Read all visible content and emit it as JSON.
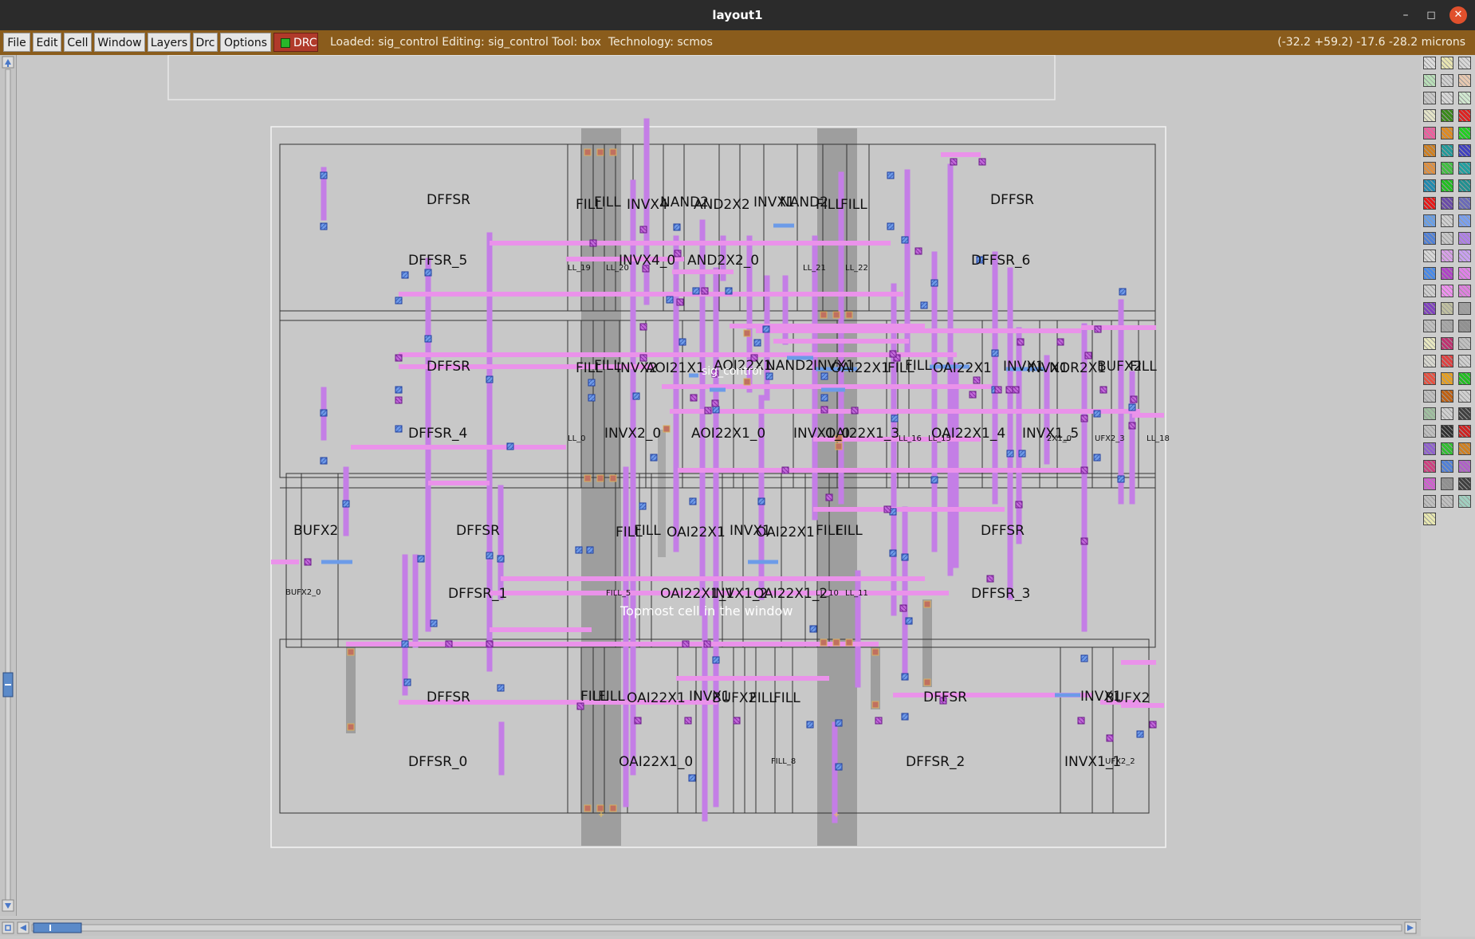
{
  "window": {
    "title": "layout1",
    "minimize": "–",
    "maximize": "◻",
    "close": "✕"
  },
  "menu": {
    "file": "File",
    "edit": "Edit",
    "cell": "Cell",
    "window": "Window",
    "layers": "Layers",
    "drc": "Drc",
    "options": "Options",
    "drc_indicator": "DRC"
  },
  "status": {
    "text": "Loaded: sig_control Editing: sig_control Tool: box  Technology: scmos",
    "coords": "(-32.2 +59.2) -17.6 -28.2 microns"
  },
  "layout": {
    "cell_name": "sig_control",
    "overlay_note": "Topmost cell in the window"
  },
  "rows": [
    {
      "label": "DFFSR",
      "instance": "DFFSR_5"
    },
    {
      "label": "DFFSR",
      "instance": "DFFSR_6"
    },
    {
      "label": "DFFSR",
      "instance": "DFFSR_4"
    },
    {
      "label": "DFFSR",
      "instance": "DFFSR_1"
    },
    {
      "label": "DFFSR",
      "instance": "DFFSR_3"
    },
    {
      "label": "DFFSR",
      "instance": "DFFSR_0"
    },
    {
      "label": "DFFSR",
      "instance": "DFFSR_2"
    }
  ],
  "cell_labels": {
    "r1": [
      "FILL",
      "FILL",
      "INVX4",
      "NAND2",
      "AND2X2",
      "INVX1",
      "NAND2",
      "FILL",
      "FILL"
    ],
    "r1i": [
      "INVX4_0",
      "AND2X2_0"
    ],
    "r2": [
      "FILL",
      "FILL",
      "INVX2",
      "AOI21X1",
      "AOI22X1",
      "NAND2",
      "INVX1",
      "OAI22X1",
      "FILL",
      "FILL",
      "OAI22X1",
      "INVX1",
      "INVX1",
      "NOR2X1",
      "BUFX2",
      "FILL"
    ],
    "r2i": [
      "INVX2_0",
      "AOI22X1_0",
      "INVX1_0",
      "OAI22X1_3",
      "OAI22X1_4",
      "INVX1_5"
    ],
    "r3": [
      "BUFX2",
      "FILL",
      "FILL",
      "OAI22X1",
      "INVX1",
      "OAI22X1",
      "FILL",
      "FILL"
    ],
    "r3i": [
      "BUFX2_0",
      "OAI22X1_1",
      "INVX1_2",
      "OAI22X1_2"
    ],
    "r4": [
      "FILL",
      "FILL",
      "OAI22X1",
      "INVX1",
      "BUFX2",
      "FILL",
      "FILL",
      "INVX1",
      "BUFX2"
    ],
    "r4i": [
      "OAI22X1_0",
      "INVX1_1"
    ],
    "tiny": [
      "LL_19",
      "LL_20",
      "LL_21",
      "LL_22",
      "LL_0",
      "LL_18",
      "LL_16",
      "LL_15",
      "FILL_5",
      "LL_10",
      "LL_11",
      "FILL_8",
      "UFX2_3",
      "2X1_0",
      "UFX2_2"
    ]
  },
  "colors": {
    "metal1": "#6495ed",
    "metal2": "#c878e0",
    "poly": "#e88ee8",
    "well": "#9a9a9a",
    "menubar": "#8a5c1c",
    "background": "#c8c8c8"
  }
}
